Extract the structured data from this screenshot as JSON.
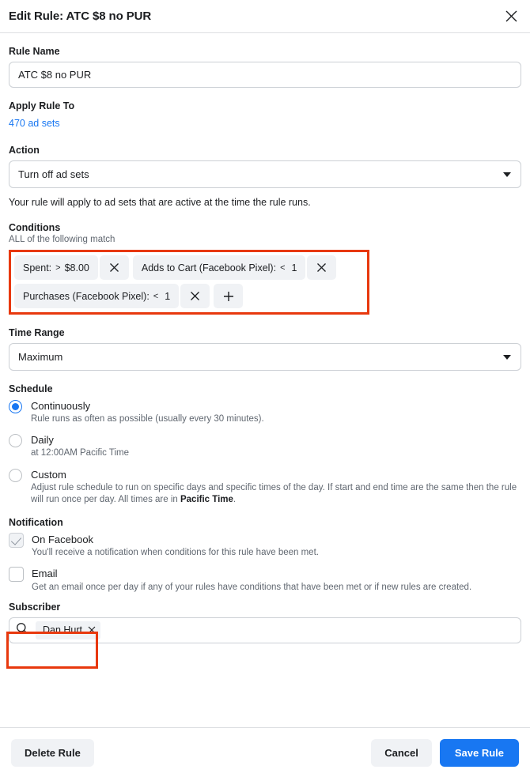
{
  "header": {
    "title": "Edit Rule: ATC $8 no PUR",
    "close_icon": "close-icon"
  },
  "rule_name": {
    "label": "Rule Name",
    "value": "ATC $8 no PUR"
  },
  "apply_rule_to": {
    "label": "Apply Rule To",
    "link_text": "470 ad sets"
  },
  "action": {
    "label": "Action",
    "selected": "Turn off ad sets",
    "caret_icon": "chevron-down-icon",
    "note": "Your rule will apply to ad sets that are active at the time the rule runs."
  },
  "conditions": {
    "label": "Conditions",
    "sublabel": "ALL of the following match",
    "highlight_color": "#e8380d",
    "rows": [
      [
        {
          "metric": "Spent:",
          "operator": ">",
          "value": "$8.00",
          "remove_icon": "close-icon"
        },
        {
          "metric": "Adds to Cart (Facebook Pixel):",
          "operator": "<",
          "value": "1",
          "remove_icon": "close-icon"
        }
      ],
      [
        {
          "metric": "Purchases (Facebook Pixel):",
          "operator": "<",
          "value": "1",
          "remove_icon": "close-icon"
        }
      ]
    ],
    "add_icon": "plus-icon"
  },
  "time_range": {
    "label": "Time Range",
    "selected": "Maximum",
    "caret_icon": "chevron-down-icon"
  },
  "schedule": {
    "label": "Schedule",
    "options": [
      {
        "title": "Continuously",
        "desc": "Rule runs as often as possible (usually every 30 minutes).",
        "selected": true
      },
      {
        "title": "Daily",
        "desc": "at 12:00AM Pacific Time",
        "selected": false
      },
      {
        "title": "Custom",
        "desc_part1": "Adjust rule schedule to run on specific days and specific times of the day. If start and end time are the same then the rule will run once per day. All times are in ",
        "desc_bold": "Pacific Time",
        "desc_part2": ".",
        "selected": false
      }
    ]
  },
  "notification": {
    "label": "Notification",
    "options": [
      {
        "title": "On Facebook",
        "desc": "You'll receive a notification when conditions for this rule have been met.",
        "checked": true
      },
      {
        "title": "Email",
        "desc": "Get an email once per day if any of your rules have conditions that have been met or if new rules are created.",
        "checked": false
      }
    ]
  },
  "subscriber": {
    "label": "Subscriber",
    "search_icon": "search-icon",
    "tokens": [
      {
        "name": "Dan Hurt",
        "remove_icon": "close-icon"
      }
    ]
  },
  "footer": {
    "delete_label": "Delete Rule",
    "cancel_label": "Cancel",
    "save_label": "Save Rule",
    "primary_color": "#1877f2"
  }
}
